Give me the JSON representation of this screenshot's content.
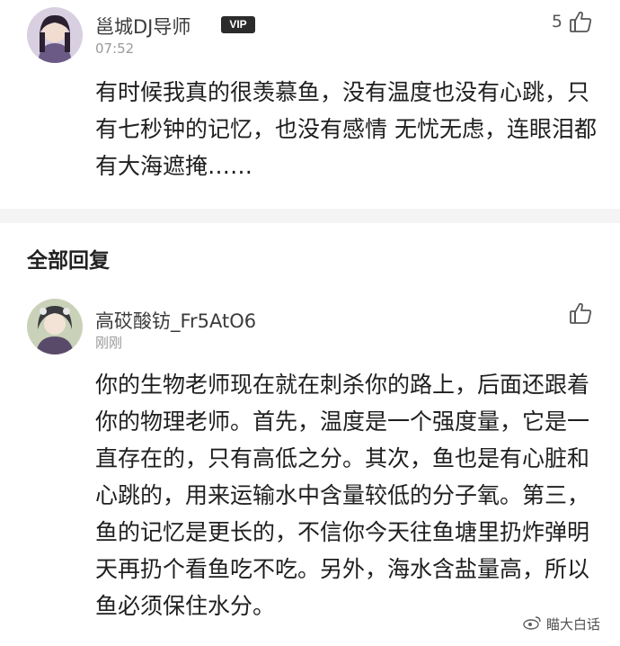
{
  "top_comment": {
    "username": "邕城DJ导师",
    "vip_badge": "VIP",
    "timestamp": "07:52",
    "like_count": "5",
    "text": "有时候我真的很羡慕鱼，没有温度也没有心跳，只有七秒钟的记忆，也没有感情 无忧无虑，连眼泪都有大海遮掩……"
  },
  "section_title": "全部回复",
  "reply_comment": {
    "username": "高砹酸钫_Fr5AtO6",
    "timestamp": "刚刚",
    "text": "你的生物老师现在就在刺杀你的路上，后面还跟着你的物理老师。首先，温度是一个强度量，它是一直存在的，只有高低之分。其次，鱼也是有心脏和心跳的，用来运输水中含量较低的分子氧。第三，鱼的记忆是更长的，不信你今天往鱼塘里扔炸弹明天再扔个看鱼吃不吃。另外，海水含盐量高，所以鱼必须保住水分。"
  },
  "watermark": {
    "text": "瞄大白话"
  },
  "icons": {
    "like": "thumbs-up-icon",
    "watermark": "weibo-icon"
  }
}
